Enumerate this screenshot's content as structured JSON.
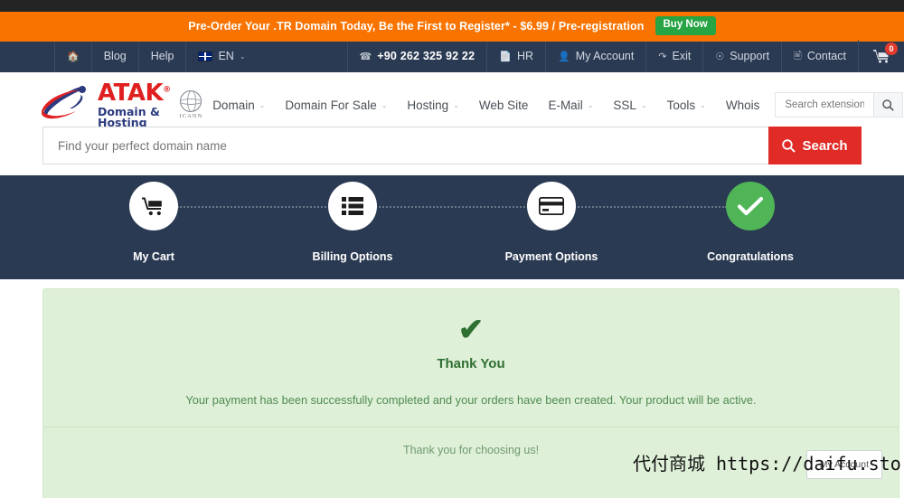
{
  "promo": {
    "text": "Pre-Order Your .TR Domain Today, Be the First to Register* - $6.99 / Pre-registration",
    "button": "Buy Now",
    "bg_color": "#f97300",
    "button_color": "#27a444"
  },
  "utilbar": {
    "left_items": [
      {
        "label": "",
        "icon": "home-icon"
      },
      {
        "label": "Blog",
        "icon": ""
      },
      {
        "label": "Help",
        "icon": ""
      },
      {
        "label": "EN",
        "icon": "flag-uk-icon",
        "caret": "⌄"
      }
    ],
    "phone": "+90 262 325 92 22",
    "right_items": [
      {
        "label": "HR",
        "icon": "document-icon"
      },
      {
        "label": "My Account",
        "icon": "user-icon"
      },
      {
        "label": "Exit",
        "icon": "exit-icon"
      },
      {
        "label": "Support",
        "icon": "support-icon"
      },
      {
        "label": "Contact",
        "icon": "contact-card-icon"
      }
    ],
    "cart_count": "0",
    "bg_color": "#2b3a53"
  },
  "logo": {
    "name": "ATAK",
    "registered": "®",
    "tagline": "Domain & Hosting",
    "accreditation": "ICANN",
    "name_color": "#e02020",
    "tagline_color": "#2b3a7e"
  },
  "mainnav": {
    "items": [
      {
        "label": "Domain",
        "caret": "⌄"
      },
      {
        "label": "Domain For Sale",
        "caret": "⌄"
      },
      {
        "label": "Hosting",
        "caret": "⌄"
      },
      {
        "label": "Web Site",
        "caret": ""
      },
      {
        "label": "E-Mail",
        "caret": "⌄"
      },
      {
        "label": "SSL",
        "caret": "⌄"
      },
      {
        "label": "Tools",
        "caret": "⌄"
      },
      {
        "label": "Whois",
        "caret": ""
      }
    ],
    "extension_search_placeholder": "Search extension"
  },
  "domain_search": {
    "placeholder": "Find your perfect domain name",
    "value": "",
    "button": "Search",
    "button_color": "#e02b26"
  },
  "steps": {
    "items": [
      {
        "label": "My Cart",
        "icon": "shopping-cart-icon",
        "state": "pending"
      },
      {
        "label": "Billing Options",
        "icon": "list-icon",
        "state": "pending"
      },
      {
        "label": "Payment Options",
        "icon": "credit-card-icon",
        "state": "pending"
      },
      {
        "label": "Congratulations",
        "icon": "check-icon",
        "state": "done"
      }
    ],
    "active_color": "#4fb557"
  },
  "success": {
    "check": "✔",
    "title": "Thank You",
    "message": "Your payment has been successfully completed and your orders have been created. Your product will be active.",
    "thanks": "Thank you for choosing us!",
    "account_button": "My Account",
    "bg_color": "#dff0d8",
    "text_color": "#2f6f32"
  },
  "watermark": {
    "text": "代付商城 https://daifu.store/"
  }
}
